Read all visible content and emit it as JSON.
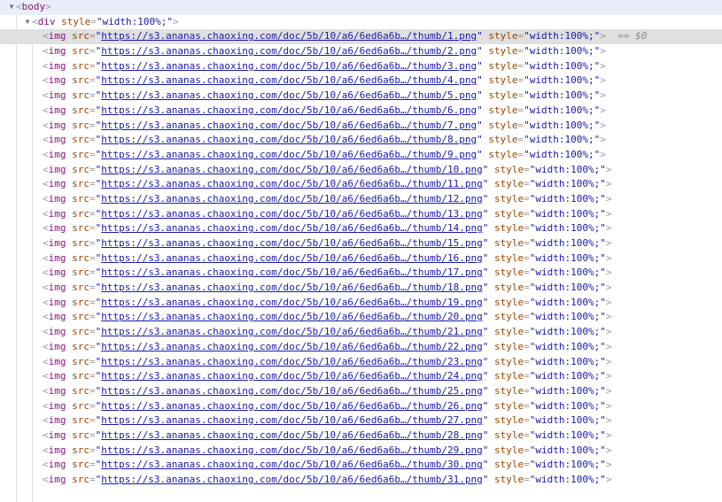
{
  "panel": {
    "name": "devtools-elements-tree",
    "background_color": "#ffffff",
    "selected_row_color": "#e0e0e0",
    "hover_row_color": "#e8effa"
  },
  "syntax_colors": {
    "tag_name": "#881280",
    "attribute_name": "#994500",
    "attribute_value": "#1a1aa6",
    "bracket": "#9a9a9a",
    "url_link": "#1a1aa6",
    "reference_marker": "#8c8c8c"
  },
  "tokens": {
    "twisty_open": "▼",
    "angle_open": "<",
    "angle_close": ">",
    "equals": "=",
    "quote": "\"",
    "reference": "== $0"
  },
  "tree": {
    "body_row": {
      "tag": "body",
      "twisty": "▼",
      "selected": "hover"
    },
    "div_row": {
      "tag": "div",
      "twisty": "▼",
      "attr_name": "style",
      "attr_value": "width:100%;",
      "selected": "none"
    },
    "img_rows_tag": "img",
    "img_attr_src_name": "src",
    "img_attr_style_name": "style",
    "img_attr_style_value": "width:100%;",
    "url_prefix": "https://s3.ananas.chaoxing.com/doc/5b/10/a6/6ed6a6b…/thumb/",
    "url_suffix": ".png",
    "img_rows": [
      {
        "n": "1",
        "selected": "selected",
        "reference": "== $0"
      },
      {
        "n": "2",
        "selected": "none",
        "reference": ""
      },
      {
        "n": "3",
        "selected": "none",
        "reference": ""
      },
      {
        "n": "4",
        "selected": "none",
        "reference": ""
      },
      {
        "n": "5",
        "selected": "none",
        "reference": ""
      },
      {
        "n": "6",
        "selected": "none",
        "reference": ""
      },
      {
        "n": "7",
        "selected": "none",
        "reference": ""
      },
      {
        "n": "8",
        "selected": "none",
        "reference": ""
      },
      {
        "n": "9",
        "selected": "none",
        "reference": ""
      },
      {
        "n": "10",
        "selected": "none",
        "reference": ""
      },
      {
        "n": "11",
        "selected": "none",
        "reference": ""
      },
      {
        "n": "12",
        "selected": "none",
        "reference": ""
      },
      {
        "n": "13",
        "selected": "none",
        "reference": ""
      },
      {
        "n": "14",
        "selected": "none",
        "reference": ""
      },
      {
        "n": "15",
        "selected": "none",
        "reference": ""
      },
      {
        "n": "16",
        "selected": "none",
        "reference": ""
      },
      {
        "n": "17",
        "selected": "none",
        "reference": ""
      },
      {
        "n": "18",
        "selected": "none",
        "reference": ""
      },
      {
        "n": "19",
        "selected": "none",
        "reference": ""
      },
      {
        "n": "20",
        "selected": "none",
        "reference": ""
      },
      {
        "n": "21",
        "selected": "none",
        "reference": ""
      },
      {
        "n": "22",
        "selected": "none",
        "reference": ""
      },
      {
        "n": "23",
        "selected": "none",
        "reference": ""
      },
      {
        "n": "24",
        "selected": "none",
        "reference": ""
      },
      {
        "n": "25",
        "selected": "none",
        "reference": ""
      },
      {
        "n": "26",
        "selected": "none",
        "reference": ""
      },
      {
        "n": "27",
        "selected": "none",
        "reference": ""
      },
      {
        "n": "28",
        "selected": "none",
        "reference": ""
      },
      {
        "n": "29",
        "selected": "none",
        "reference": ""
      },
      {
        "n": "30",
        "selected": "none",
        "reference": ""
      },
      {
        "n": "31",
        "selected": "none",
        "reference": ""
      }
    ]
  }
}
